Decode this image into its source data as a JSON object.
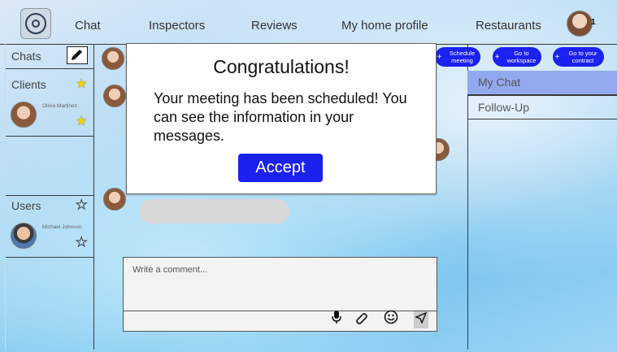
{
  "nav": {
    "items": [
      "Chat",
      "Inspectors",
      "Reviews",
      "My home profile",
      "Restaurants"
    ],
    "notification_count": "1"
  },
  "left": {
    "chats_label": "Chats",
    "clients_label": "Clients",
    "client_name": "Olivia Martinez",
    "users_label": "Users",
    "user_name": "Michael Johnson"
  },
  "actions": {
    "schedule": "Schedule meeting",
    "workspace": "Go to workspace",
    "contract": "Go to your contract"
  },
  "right": {
    "tabs": [
      "My Chat",
      "Follow-Up"
    ],
    "active_tab": "My Chat"
  },
  "composer": {
    "placeholder": "Write a comment..."
  },
  "modal": {
    "title": "Congratulations!",
    "message": "Your meeting has been scheduled! You can see the information in your messages.",
    "accept_label": "Accept"
  },
  "colors": {
    "accent": "#1b21ef",
    "active_tab": "#93a9ef",
    "star": "#f4d400"
  },
  "icons": [
    "logo-icon",
    "edit-icon",
    "star-icon",
    "microphone-icon",
    "attachment-icon",
    "emoji-icon",
    "send-icon"
  ]
}
